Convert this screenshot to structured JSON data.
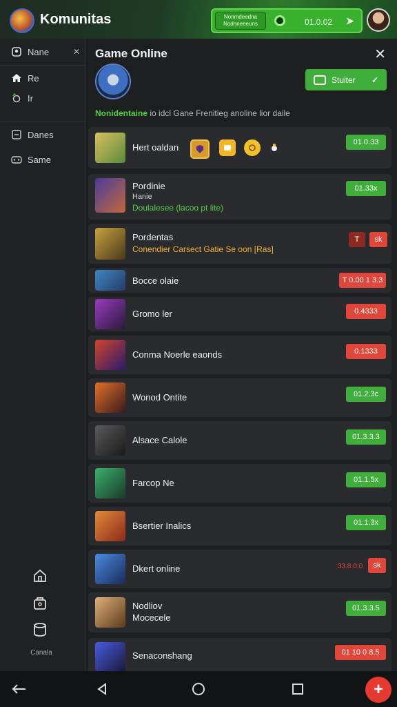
{
  "app": {
    "title": "Komunitas"
  },
  "banner": {
    "left_text": "Nonmdeedna\nNodnneeeuns",
    "value": "01.0.02"
  },
  "sidebar": {
    "items": [
      {
        "label": "Nane",
        "icon": "user-icon"
      },
      {
        "label": "Re",
        "icon": "home-icon"
      },
      {
        "label": "Ir",
        "icon": "circle-icon"
      },
      {
        "label": "Danes",
        "icon": "list-icon"
      },
      {
        "label": "Same",
        "icon": "gamepad-icon"
      }
    ],
    "bottom_label": "Canala"
  },
  "panel": {
    "title": "Game Online",
    "start_label": "Stuiter",
    "subtitle_highlight": "Nonidentaine",
    "subtitle_rest": "io idcl Gane  Frenitieg anoline lior daile"
  },
  "games": [
    {
      "title": "Hert oaldan",
      "badge": "01.0.33",
      "badge_color": "green",
      "accent": "#b8a94c"
    },
    {
      "title": "Pordinie",
      "sub": "Hanie",
      "note": "Doulalesee (lacoo pt lite)",
      "note_color": "#4fd046",
      "badge": "01.33x",
      "badge_color": "green",
      "accent": "#6a3a8a"
    },
    {
      "title": "Pordentas",
      "note": "Conendier Carsect Gatie Se oon [Ras]",
      "note_color": "#f1b52a",
      "badge": "sk",
      "badge2": "T",
      "badge_color": "red",
      "accent": "#a8822a"
    },
    {
      "title": "Bocce olaie",
      "badge": "T 0.00 1 3.3",
      "badge_color": "red",
      "accent": "#3a6fb0"
    },
    {
      "title": "Gromo ler",
      "badge": "0.4333",
      "badge_color": "red",
      "accent": "#8a3ab0"
    },
    {
      "title": "Conma Noerle eaonds",
      "badge": "0.1333",
      "badge_color": "red",
      "accent": "#b03a3a"
    },
    {
      "title": "Wonod Ontite",
      "badge": "01.2.3c",
      "badge_color": "green",
      "accent": "#b0462a"
    },
    {
      "title": "Alsace Calole",
      "badge": "01.3.3.3",
      "badge_color": "green",
      "accent": "#2a2a2a"
    },
    {
      "title": "Farcop Ne",
      "badge": "01.1.5x",
      "badge_color": "green",
      "accent": "#2a6a3a"
    },
    {
      "title": "Bsertier Inalics",
      "badge": "01.1.3x",
      "badge_color": "green",
      "accent": "#b0582a"
    },
    {
      "title": "Dkert online",
      "badge": "33.8.0.0",
      "badge2": "sk",
      "badge_color": "red",
      "accent": "#3a5ab0"
    },
    {
      "title": "Nodliov",
      "sub": "Mocecele",
      "badge": "01.3.3.5",
      "badge_color": "green",
      "accent": "#b0823a"
    },
    {
      "title": "Senaconshang",
      "badge": "01 10 0 8.5",
      "badge_color": "red",
      "accent": "#3a4ab0"
    }
  ],
  "icons": {
    "first_row": [
      "shield-icon",
      "star-icon",
      "coin-icon",
      "bug-icon"
    ]
  }
}
